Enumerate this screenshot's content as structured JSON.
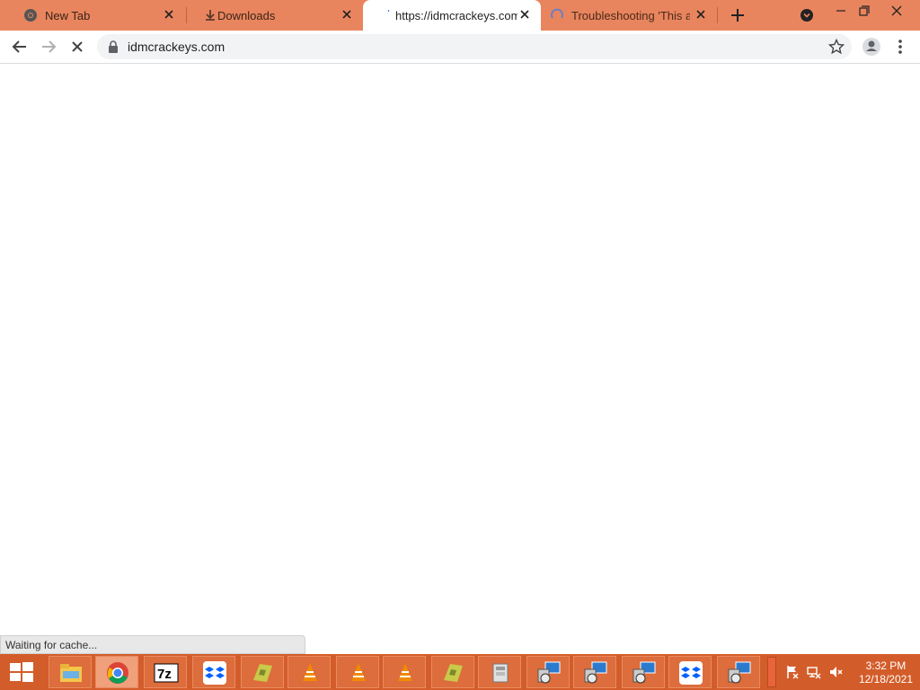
{
  "tabs": [
    {
      "title": "New Tab",
      "icon": "chrome-icon",
      "active": false
    },
    {
      "title": "Downloads",
      "icon": "download-icon",
      "active": false
    },
    {
      "title": "https://idmcrackeys.com",
      "icon": "loading-icon",
      "active": true
    },
    {
      "title": "Troubleshooting 'This ap",
      "icon": "loading-spinner-icon",
      "active": false
    }
  ],
  "address_bar": {
    "url": "idmcrackeys.com"
  },
  "status_bar": {
    "text": "Waiting for cache..."
  },
  "taskbar": {
    "items": [
      "file-explorer",
      "chrome",
      "7zip",
      "dropbox",
      "folder",
      "vlc",
      "vlc",
      "vlc",
      "folder",
      "archive",
      "remote-desktop",
      "remote-desktop",
      "remote-desktop",
      "dropbox",
      "remote-desktop"
    ],
    "time": "3:32 PM",
    "date": "12/18/2021"
  },
  "colors": {
    "titlebar": "#e9855e",
    "taskbar": "#d35d2a",
    "accent": "#1a73e8"
  }
}
